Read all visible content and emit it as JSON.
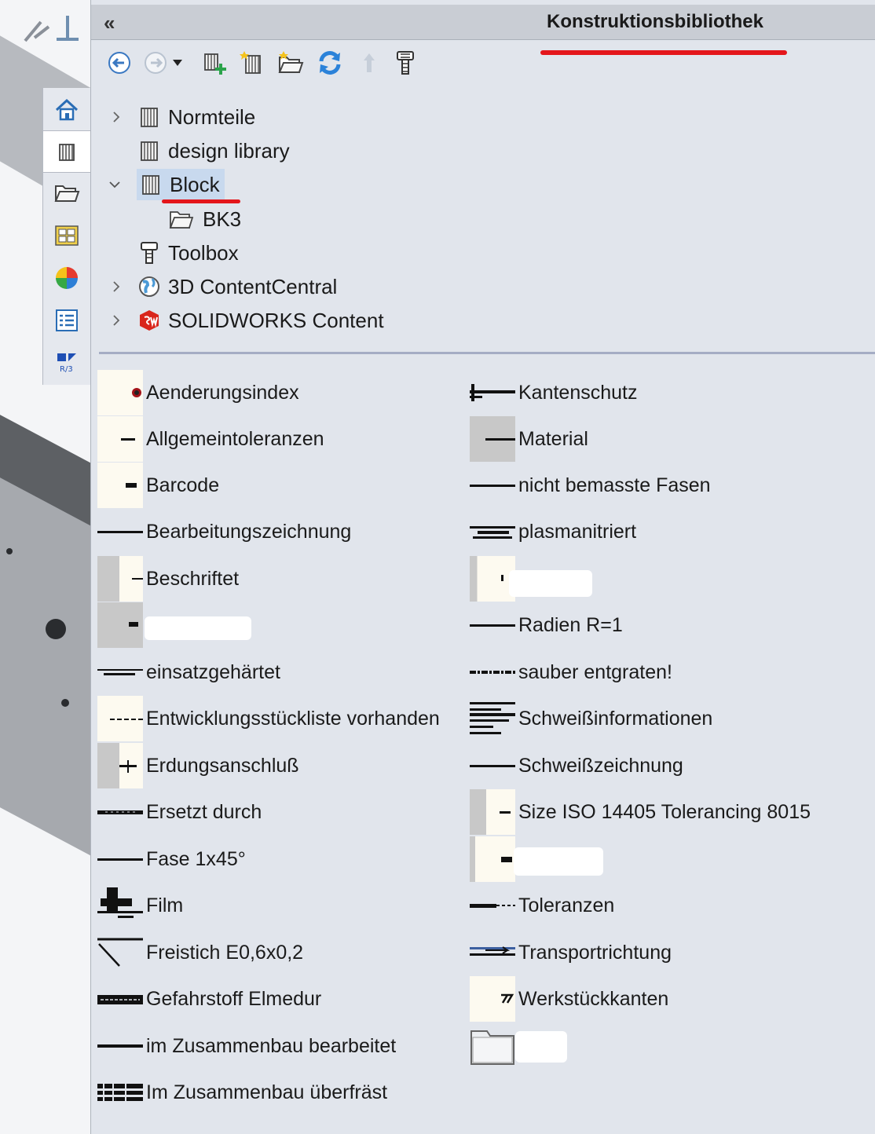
{
  "panel": {
    "title": "Konstruktionsbibliothek",
    "collapse_label": "«"
  },
  "toolbar": {
    "buttons": [
      "back-icon",
      "forward-icon",
      "dropdown-arrow-icon",
      "add-library-icon",
      "create-library-icon",
      "add-folder-icon",
      "refresh-icon",
      "up-icon",
      "toolbox-icon"
    ]
  },
  "tabs": [
    "home-icon",
    "design-library-icon",
    "file-explorer-icon",
    "view-palette-icon",
    "appearances-icon",
    "custom-properties-icon",
    "rs-icon"
  ],
  "tree": [
    {
      "label": "Normteile",
      "expandable": true,
      "expanded": false,
      "icon": "library-icon"
    },
    {
      "label": "design library",
      "expandable": false,
      "icon": "library-icon"
    },
    {
      "label": "Block",
      "expandable": true,
      "expanded": true,
      "selected": true,
      "icon": "library-icon"
    },
    {
      "label": "BK3",
      "icon": "folder-icon",
      "child": true
    },
    {
      "label": "Toolbox",
      "expandable": false,
      "icon": "toolbox-icon"
    },
    {
      "label": "3D ContentCentral",
      "expandable": true,
      "expanded": false,
      "icon": "globe-icon"
    },
    {
      "label": "SOLIDWORKS Content",
      "expandable": true,
      "expanded": false,
      "icon": "solidworks-icon"
    }
  ],
  "blocks_left": [
    "Aenderungsindex",
    "Allgemeintoleranzen",
    "Barcode",
    "Bearbeitungszeichnung",
    "Beschriftet",
    "",
    "einsatzgehärtet",
    "Entwicklungsstückliste vorhanden",
    "Erdungsanschluß",
    "Ersetzt durch",
    "Fase 1x45°",
    "Film",
    "Freistich E0,6x0,2",
    "Gefahrstoff Elmedur",
    "im Zusammenbau bearbeitet",
    "Im Zusammenbau überfräst"
  ],
  "blocks_right": [
    "Kantenschutz",
    "Material",
    "nicht bemasste Fasen",
    "plasmanitriert",
    "",
    "Radien R=1",
    "sauber entgraten!",
    "Schweißinformationen",
    "Schweißzeichnung",
    "Size ISO 14405 Tolerancing 8015",
    "",
    "Toleranzen",
    "Transportrichtung",
    "Werkstückkanten",
    ""
  ],
  "colors": {
    "accent_red": "#e4161b",
    "panel_bg": "#e1e5ec",
    "selection": "#c8d9ee"
  }
}
